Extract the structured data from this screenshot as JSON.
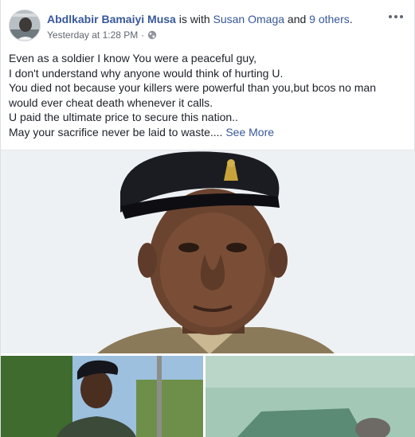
{
  "post": {
    "author": "Abdlkabir Bamaiyi Musa",
    "with_text": " is with ",
    "tagged_person": "Susan Omaga",
    "and_text": " and ",
    "others": "9 others",
    "period": ".",
    "timestamp": "Yesterday at 1:28 PM",
    "separator": "·",
    "privacy_icon": "globe-icon",
    "menu_icon": "more-options-icon"
  },
  "body": {
    "lines": [
      "Even as a soldier I know You were a peaceful guy,",
      "I don't understand why anyone would think of hurting U.",
      "You died not because your killers were powerful than you,but bcos no man",
      "would ever cheat death whenever it calls.",
      "U paid the ultimate price to secure this nation..",
      "May your sacrifice never be laid to waste...."
    ],
    "see_more": "See More"
  },
  "colors": {
    "link": "#385898",
    "text": "#1d2129",
    "meta": "#616770"
  }
}
